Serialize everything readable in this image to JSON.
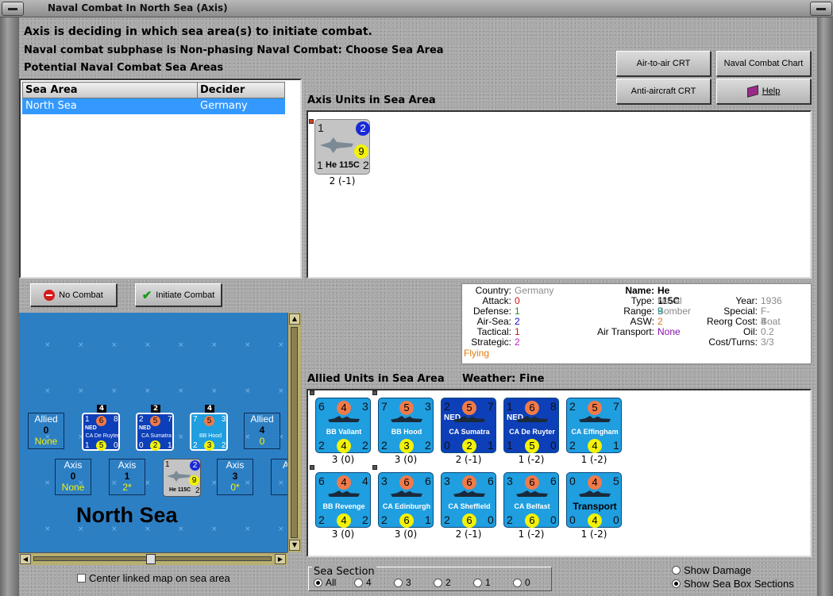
{
  "window": {
    "title": "Naval Combat In North Sea (Axis)"
  },
  "header": {
    "line1": "Axis is deciding in which sea area(s) to initiate combat.",
    "line2": "Naval combat subphase is Non-phasing Naval Combat: Choose Sea Area",
    "line3": "Potential Naval Combat Sea Areas"
  },
  "buttons": {
    "air_to_air": "Air-to-air CRT",
    "naval_chart": "Naval Combat Chart",
    "anti_aircraft": "Anti-aircraft CRT",
    "help": "Help",
    "no_combat": "No Combat",
    "initiate": "Initiate Combat"
  },
  "sea_table": {
    "headers": [
      "Sea Area",
      "Decider"
    ],
    "rows": [
      [
        "North Sea",
        "Germany"
      ]
    ]
  },
  "axis_units": {
    "title": "Axis Units in Sea Area",
    "units": [
      {
        "tl": "1",
        "tr": "2",
        "mid": "9",
        "name": "He 115C",
        "bl": "1",
        "br": "2",
        "caption": "2 (-1)"
      }
    ]
  },
  "unit_info": {
    "country_label": "Country:",
    "country": "Germany",
    "attack_label": "Attack:",
    "attack": "0",
    "defense_label": "Defense:",
    "defense": "1",
    "airsea_label": "Air-Sea:",
    "airsea": "2",
    "tactical_label": "Tactical:",
    "tactical": "1",
    "strategic_label": "Strategic:",
    "strategic": "2",
    "status": "Flying",
    "name_label": "Name:",
    "name": "He 115C",
    "type_label": "Type:",
    "type": "Naval Bomber",
    "year_label": "Year:",
    "year": "1936",
    "range_label": "Range:",
    "range": "9",
    "special_label": "Special:",
    "special": "F-Boat",
    "asw_label": "ASW:",
    "asw": "2",
    "reorg_label": "Reorg Cost:",
    "reorg": "4",
    "airtrans_label": "Air Transport:",
    "airtrans": "None",
    "oil_label": "Oil:",
    "oil": "0.2",
    "cost_label": "Cost/Turns:",
    "cost": "3/3"
  },
  "allied_units": {
    "title": "Allied Units in Sea Area",
    "weather_label": "Weather:",
    "weather": "Fine",
    "row1": [
      {
        "tl": "6",
        "tc": "4",
        "tr": "3",
        "name": "BB Valiant",
        "bl": "2",
        "bc": "4",
        "br": "2",
        "caption": "3 (0)",
        "ned": ""
      },
      {
        "tl": "7",
        "tc": "5",
        "tr": "3",
        "name": "BB Hood",
        "bl": "2",
        "bc": "3",
        "br": "2",
        "caption": "3 (0)",
        "ned": ""
      },
      {
        "tl": "2",
        "tc": "5",
        "tr": "7",
        "name": "CA Sumatra",
        "bl": "0",
        "bc": "2",
        "br": "1",
        "caption": "2 (-1)",
        "ned": "NED"
      },
      {
        "tl": "1",
        "tc": "6",
        "tr": "8",
        "name": "CA De Ruyter",
        "bl": "1",
        "bc": "5",
        "br": "0",
        "caption": "1 (-2)",
        "ned": "NED"
      },
      {
        "tl": "2",
        "tc": "5",
        "tr": "7",
        "name": "CA Effingham",
        "bl": "2",
        "bc": "4",
        "br": "1",
        "caption": "1 (-2)",
        "ned": ""
      }
    ],
    "row2": [
      {
        "tl": "6",
        "tc": "4",
        "tr": "4",
        "name": "BB Revenge",
        "bl": "2",
        "bc": "4",
        "br": "2",
        "caption": "3 (0)",
        "ned": ""
      },
      {
        "tl": "3",
        "tc": "6",
        "tr": "6",
        "name": "CA Edinburgh",
        "bl": "2",
        "bc": "6",
        "br": "1",
        "caption": "3 (0)",
        "ned": ""
      },
      {
        "tl": "3",
        "tc": "6",
        "tr": "6",
        "name": "CA Sheffield",
        "bl": "2",
        "bc": "6",
        "br": "0",
        "caption": "2 (-1)",
        "ned": ""
      },
      {
        "tl": "3",
        "tc": "6",
        "tr": "6",
        "name": "CA Belfast",
        "bl": "2",
        "bc": "6",
        "br": "0",
        "caption": "1 (-2)",
        "ned": ""
      },
      {
        "tl": "0",
        "tc": "4",
        "tr": "5",
        "name": "Transport",
        "bl": "0",
        "bc": "4",
        "br": "0",
        "caption": "1 (-2)",
        "ned": ""
      }
    ]
  },
  "map": {
    "sea_name": "North Sea",
    "allied_left": {
      "label": "Allied",
      "value": "0",
      "sub": "None"
    },
    "allied_right": {
      "label": "Allied",
      "value": "4",
      "sub": "0"
    },
    "axis_boxes": [
      {
        "label": "Axis",
        "value": "0",
        "sub": "None"
      },
      {
        "label": "Axis",
        "value": "1",
        "sub": "2*"
      },
      {
        "label": "Axis",
        "value": "3",
        "sub": "0*"
      },
      {
        "label": "A"
      }
    ],
    "stack_counts": [
      "4",
      "2",
      "4"
    ],
    "mini_ships": [
      {
        "tl": "1",
        "tc": "6",
        "tr": "8",
        "ned": "NED",
        "name": "CA De Ruyter",
        "bl": "1",
        "bc": "5",
        "br": "0"
      },
      {
        "tl": "2",
        "tc": "5",
        "tr": "7",
        "ned": "NED",
        "name": "CA Sumatra",
        "bl": "0",
        "bc": "2",
        "br": "1"
      },
      {
        "tl": "7",
        "tc": "5",
        "tr": "3",
        "ned": "",
        "name": "BB Hood",
        "bl": "2",
        "bc": "3",
        "br": "2"
      }
    ],
    "mini_plane": {
      "tl": "1",
      "tr": "2",
      "mid": "9",
      "name": "He 115C",
      "br": "2"
    }
  },
  "options": {
    "center_linked": "Center linked map on sea area",
    "show_damage": "Show Damage",
    "show_sea_box": "Show Sea Box Sections"
  },
  "sea_section": {
    "title": "Sea Section",
    "options": [
      "All",
      "4",
      "3",
      "2",
      "1",
      "0"
    ]
  },
  "colors": {
    "ship_blue": "#1f9ee0",
    "ned_blue": "#0d3fb8",
    "orange_circle": "#f07a4a",
    "yellow_circle": "#f2f20a",
    "plane_gray": "#c4c4c4",
    "selection": "#3399ff"
  }
}
